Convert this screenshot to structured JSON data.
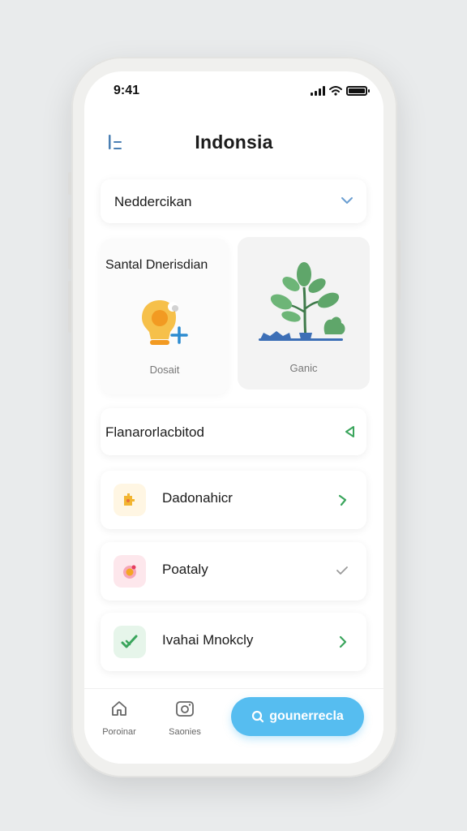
{
  "status_bar": {
    "time": "9:41"
  },
  "header": {
    "title": "Indonsia"
  },
  "dropdown": {
    "label": "Neddercikan"
  },
  "tiles": {
    "left": {
      "title": "Santal Dnerisdian",
      "caption": "Dosait"
    },
    "right": {
      "caption": "Ganic"
    }
  },
  "section": {
    "label": "Flanarorlacbitod"
  },
  "rows": [
    {
      "label": "Dadonahicr",
      "icon": "puzzle-icon",
      "icon_bg": "#fff6e3",
      "chevron_color": "#3aa55c"
    },
    {
      "label": "Poataly",
      "icon": "record-icon",
      "icon_bg": "#fde7ec",
      "chevron_color": "#9a9a9a"
    },
    {
      "label": "Ivahai Mnokcly",
      "icon": "check-icon",
      "icon_bg": "#e6f5ea",
      "chevron_color": "#3aa55c"
    }
  ],
  "tabbar": {
    "tabs": [
      {
        "label": "Poroinar",
        "icon": "home-icon"
      },
      {
        "label": "Saonies",
        "icon": "camera-icon"
      }
    ],
    "cta_label": "gounerrecla"
  },
  "colors": {
    "accent": "#56bdf0",
    "green": "#3aa55c",
    "menu_blue": "#4a7fb3"
  }
}
